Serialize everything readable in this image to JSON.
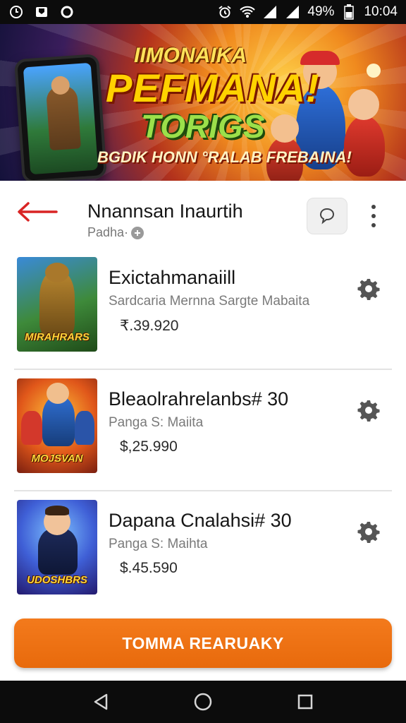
{
  "status_bar": {
    "battery": "49%",
    "time": "10:04",
    "icons": [
      "clock-icon",
      "mail-icon",
      "circle-icon",
      "alarm-icon",
      "wifi-icon",
      "signal-icon",
      "battery-icon"
    ]
  },
  "banner": {
    "line1": "IIMONAIKA",
    "line2": "PEFMANA!",
    "line3": "TORIGS",
    "line4": "BGDIK HONN °RALAB FREBAINA!"
  },
  "header": {
    "title": "Nnannsan Inaurtih",
    "subtitle": "Padha·"
  },
  "items": [
    {
      "title": "Exictahmanaiill",
      "subtitle": "Sardcaria Mernna Sargte  Mabaita",
      "price": "₹.39.920",
      "thumb_label": "MIRAHRARS"
    },
    {
      "title": "Bleaolrahrelanbs# 30",
      "subtitle": "Panga S: Maiita",
      "price": "$,25.990",
      "thumb_label": "MOJSVAN"
    },
    {
      "title": "Dapana Cnalahsi# 30",
      "subtitle": "Panga S: Maihta",
      "price": "$.45.590",
      "thumb_label": "UDOSHBRS"
    }
  ],
  "cta": {
    "label": "TOMMA REARUAKY"
  },
  "colors": {
    "accent": "#ef7317",
    "back_arrow": "#d92424",
    "status_bar": "#0c0c0c"
  }
}
